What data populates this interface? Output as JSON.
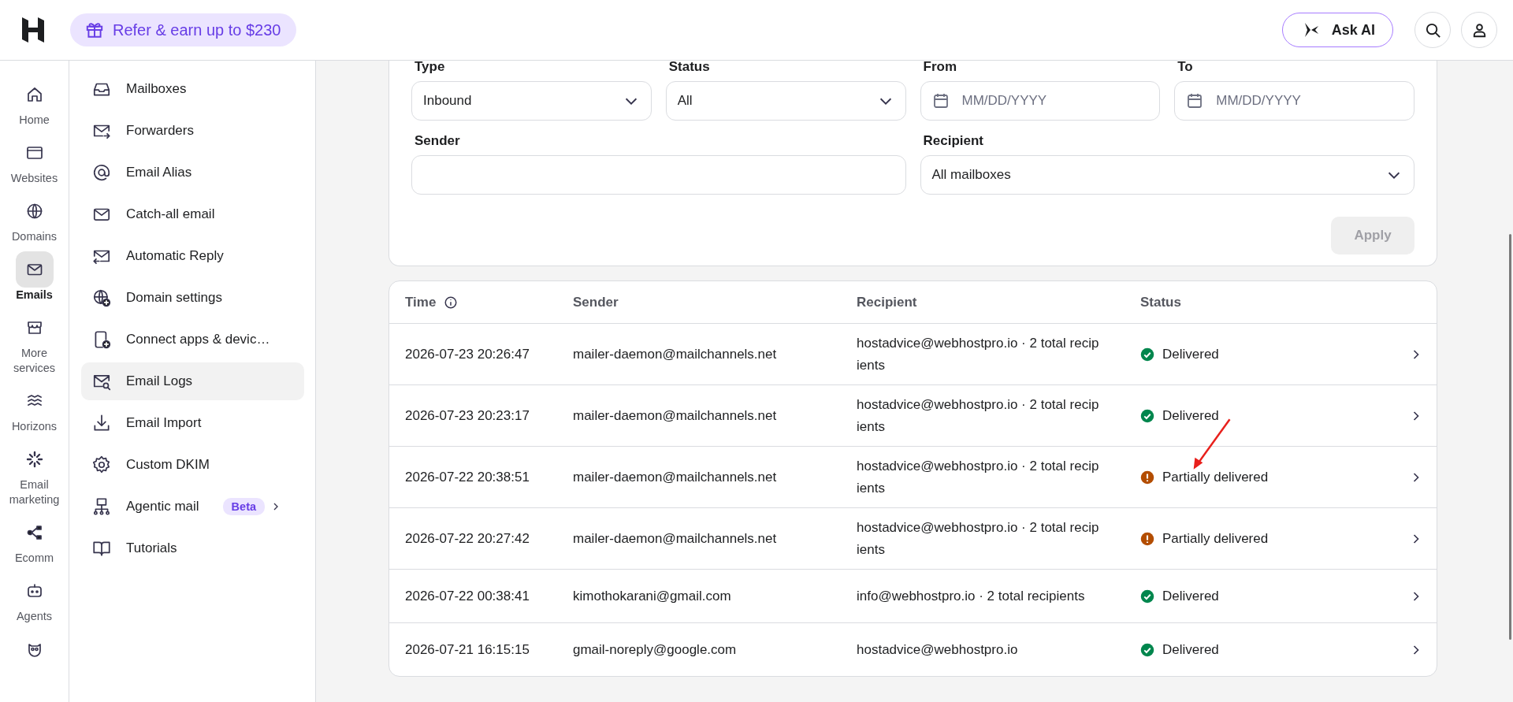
{
  "header": {
    "referral": "Refer & earn up to $230",
    "ask_ai": "Ask AI"
  },
  "rail": [
    {
      "label": "Home",
      "selected": false
    },
    {
      "label": "Websites",
      "selected": false
    },
    {
      "label": "Domains",
      "selected": false
    },
    {
      "label": "Emails",
      "selected": true
    },
    {
      "label": "More services",
      "selected": false
    },
    {
      "label": "Horizons",
      "selected": false
    },
    {
      "label": "Email marketing",
      "selected": false
    },
    {
      "label": "Ecomm",
      "selected": false
    },
    {
      "label": "Agents",
      "selected": false
    },
    {
      "selected": false
    }
  ],
  "sidebar": {
    "items": [
      {
        "label": "Mailboxes",
        "selected": false
      },
      {
        "label": "Forwarders",
        "selected": false
      },
      {
        "label": "Email Alias",
        "selected": false
      },
      {
        "label": "Catch-all email",
        "selected": false
      },
      {
        "label": "Automatic Reply",
        "selected": false
      },
      {
        "label": "Domain settings",
        "selected": false
      },
      {
        "label": "Connect apps & devic…",
        "selected": false
      },
      {
        "label": "Email Logs",
        "selected": true
      },
      {
        "label": "Email Import",
        "selected": false
      },
      {
        "label": "Custom DKIM",
        "selected": false
      },
      {
        "label": "Agentic mail",
        "selected": false,
        "badge": "Beta"
      },
      {
        "label": "Tutorials",
        "selected": false
      }
    ]
  },
  "filters": {
    "type": {
      "label": "Type",
      "value": "Inbound"
    },
    "status": {
      "label": "Status",
      "value": "All"
    },
    "from": {
      "label": "From",
      "placeholder": "MM/DD/YYYY"
    },
    "to": {
      "label": "To",
      "placeholder": "MM/DD/YYYY"
    },
    "sender": {
      "label": "Sender"
    },
    "recipient": {
      "label": "Recipient",
      "value": "All mailboxes"
    },
    "apply": {
      "label": "Apply",
      "disabled": true
    }
  },
  "table": {
    "columns": [
      "Time",
      "Sender",
      "Recipient",
      "Status"
    ],
    "rows": [
      {
        "time": "2026-07-23 20:26:47",
        "sender": "mailer-daemon@mailchannels.net",
        "recipient": "hostadvice@webhostpro.io · 2 total recip ients",
        "status": "Delivered",
        "kind": "delivered"
      },
      {
        "time": "2026-07-23 20:23:17",
        "sender": "mailer-daemon@mailchannels.net",
        "recipient": "hostadvice@webhostpro.io · 2 total recip ients",
        "status": "Delivered",
        "kind": "delivered"
      },
      {
        "time": "2026-07-22 20:38:51",
        "sender": "mailer-daemon@mailchannels.net",
        "recipient": "hostadvice@webhostpro.io · 2 total recip ients",
        "status": "Partially delivered",
        "kind": "partial"
      },
      {
        "time": "2026-07-22 20:27:42",
        "sender": "mailer-daemon@mailchannels.net",
        "recipient": "hostadvice@webhostpro.io · 2 total recip ients",
        "status": "Partially delivered",
        "kind": "partial"
      },
      {
        "time": "2026-07-22 00:38:41",
        "sender": "kimothokarani@gmail.com",
        "recipient": "info@webhostpro.io · 2 total recipients",
        "status": "Delivered",
        "kind": "delivered"
      },
      {
        "time": "2026-07-21 16:15:15",
        "sender": "gmail-noreply@google.com",
        "recipient": "hostadvice@webhostpro.io",
        "status": "Delivered",
        "kind": "delivered"
      }
    ]
  }
}
